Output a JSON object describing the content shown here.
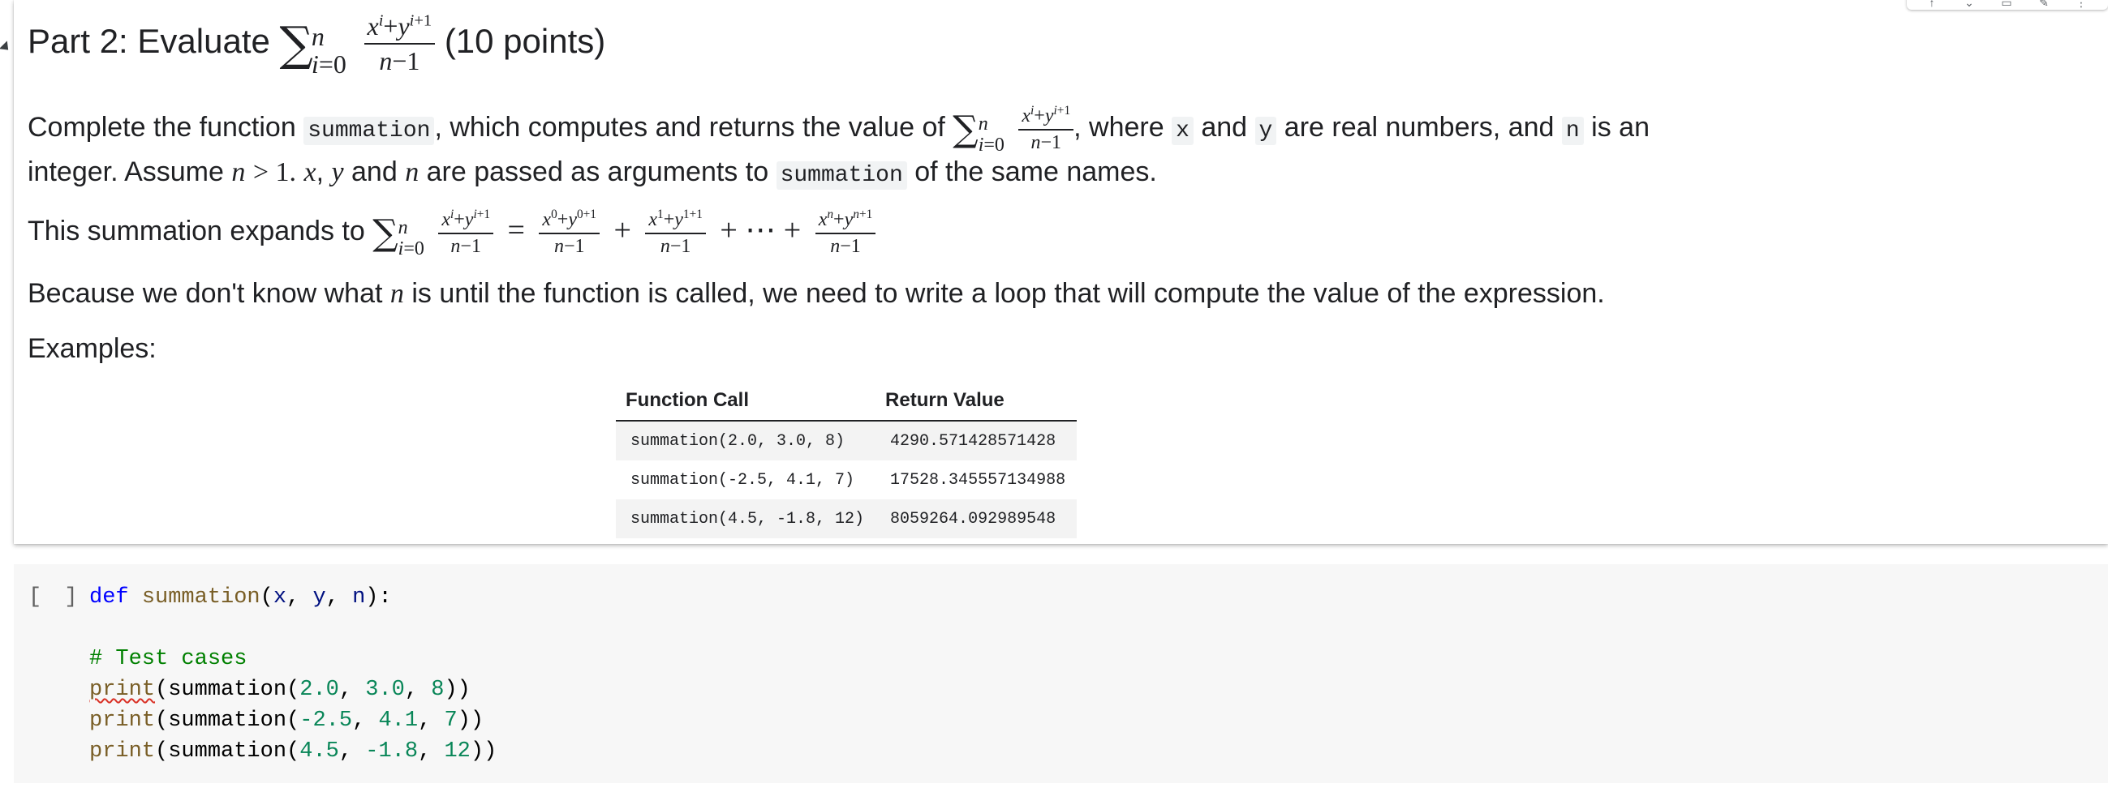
{
  "text_cell": {
    "heading_prefix": "Part 2: Evaluate",
    "heading_suffix": "(10 points)",
    "para1_a": "Complete the function",
    "para1_fn": "summation",
    "para1_b": ", which computes and returns the value of",
    "para1_c": ", where",
    "para1_x": "x",
    "para1_and1": "and",
    "para1_y": "y",
    "para1_d": "are real numbers, and",
    "para1_n": "n",
    "para1_e": "is an",
    "para2_a": "integer. Assume",
    "para2_b": "are passed as arguments to",
    "para2_fn": "summation",
    "para2_c": "of the same names.",
    "para3_a": "This summation expands to",
    "para4_a": "Because we don't know what",
    "para4_b": "is until the function is called, we need to write a loop that will compute the value of the expression.",
    "examples_label": "Examples:"
  },
  "examples_table": {
    "headers": [
      "Function Call",
      "Return Value"
    ],
    "rows": [
      [
        "summation(2.0, 3.0, 8)",
        "4290.571428571428"
      ],
      [
        "summation(-2.5, 4.1, 7)",
        "17528.345557134988"
      ],
      [
        "summation(4.5, -1.8, 12)",
        "8059264.092989548"
      ]
    ]
  },
  "code_cell": {
    "run_indicator": "[ ]",
    "lines": [
      "def summation(x, y, n):",
      "",
      "# Test cases",
      "print(summation(2.0, 3.0, 8))",
      "print(summation(-2.5, 4.1, 7))",
      "print(summation(4.5, -1.8, 12))"
    ]
  },
  "colors": {
    "keyword": "#0000ff",
    "function": "#795e26",
    "comment": "#008000",
    "number": "#098658",
    "code_bg": "#f7f7f7"
  }
}
